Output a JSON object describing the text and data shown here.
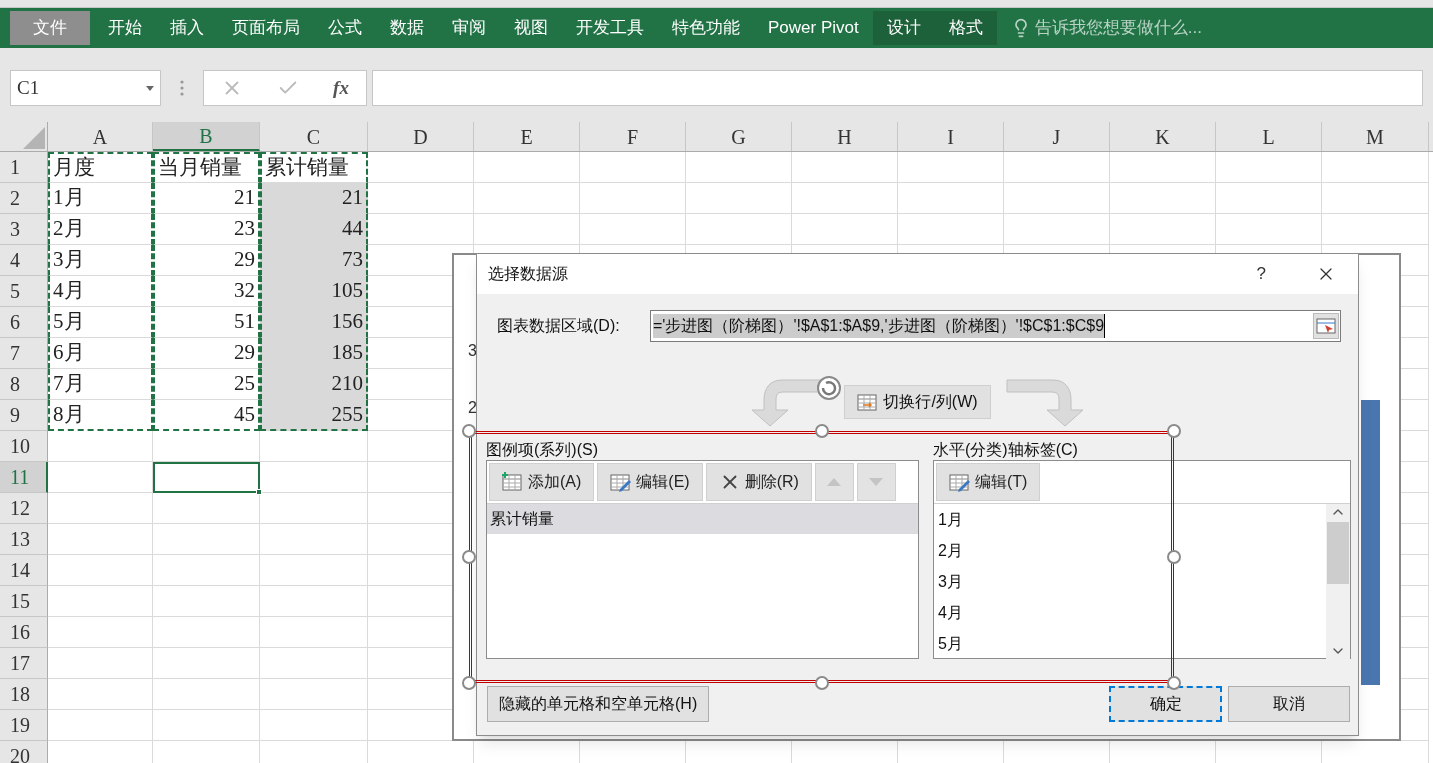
{
  "ribbon": {
    "tabs": [
      {
        "label": "文件",
        "kind": "file",
        "selected": false
      },
      {
        "label": "开始",
        "kind": "normal",
        "selected": false
      },
      {
        "label": "插入",
        "kind": "normal",
        "selected": false
      },
      {
        "label": "页面布局",
        "kind": "normal",
        "selected": false
      },
      {
        "label": "公式",
        "kind": "normal",
        "selected": false
      },
      {
        "label": "数据",
        "kind": "normal",
        "selected": false
      },
      {
        "label": "审阅",
        "kind": "normal",
        "selected": false
      },
      {
        "label": "视图",
        "kind": "normal",
        "selected": false
      },
      {
        "label": "开发工具",
        "kind": "normal",
        "selected": false
      },
      {
        "label": "特色功能",
        "kind": "normal",
        "selected": false
      },
      {
        "label": "Power Pivot",
        "kind": "normal",
        "selected": false
      },
      {
        "label": "设计",
        "kind": "context",
        "selected": false
      },
      {
        "label": "格式",
        "kind": "context",
        "selected": false
      }
    ],
    "tell_me": {
      "placeholder": "告诉我您想要做什么..."
    }
  },
  "formula_bar": {
    "name_box": "C1",
    "function_label": "fx"
  },
  "sheet": {
    "columns": [
      {
        "label": "A",
        "selected": false
      },
      {
        "label": "B",
        "selected": true
      },
      {
        "label": "C",
        "selected": false
      },
      {
        "label": "D",
        "selected": false
      },
      {
        "label": "E",
        "selected": false
      },
      {
        "label": "F",
        "selected": false
      },
      {
        "label": "G",
        "selected": false
      },
      {
        "label": "H",
        "selected": false
      },
      {
        "label": "I",
        "selected": false
      },
      {
        "label": "J",
        "selected": false
      },
      {
        "label": "K",
        "selected": false
      },
      {
        "label": "L",
        "selected": false
      },
      {
        "label": "M",
        "selected": false
      }
    ],
    "rows": [
      {
        "label": "1",
        "selected": false,
        "cells": [
          {
            "text": "月度",
            "kind": "text",
            "marquee": true,
            "highlighted": false,
            "selected": false
          },
          {
            "text": "当月销量",
            "kind": "text",
            "marquee": true,
            "highlighted": false,
            "selected": false
          },
          {
            "text": "累计销量",
            "kind": "text",
            "marquee": true,
            "highlighted": false,
            "selected": false
          }
        ]
      },
      {
        "label": "2",
        "selected": false,
        "cells": [
          {
            "text": "1月",
            "kind": "text",
            "marquee": true,
            "highlighted": false,
            "selected": false
          },
          {
            "text": "21",
            "kind": "number",
            "marquee": true,
            "highlighted": false,
            "selected": false
          },
          {
            "text": "21",
            "kind": "number",
            "marquee": true,
            "highlighted": true,
            "selected": false
          }
        ]
      },
      {
        "label": "3",
        "selected": false,
        "cells": [
          {
            "text": "2月",
            "kind": "text",
            "marquee": true,
            "highlighted": false,
            "selected": false
          },
          {
            "text": "23",
            "kind": "number",
            "marquee": true,
            "highlighted": false,
            "selected": false
          },
          {
            "text": "44",
            "kind": "number",
            "marquee": true,
            "highlighted": true,
            "selected": false
          }
        ]
      },
      {
        "label": "4",
        "selected": false,
        "cells": [
          {
            "text": "3月",
            "kind": "text",
            "marquee": true,
            "highlighted": false,
            "selected": false
          },
          {
            "text": "29",
            "kind": "number",
            "marquee": true,
            "highlighted": false,
            "selected": false
          },
          {
            "text": "73",
            "kind": "number",
            "marquee": true,
            "highlighted": true,
            "selected": false
          }
        ]
      },
      {
        "label": "5",
        "selected": false,
        "cells": [
          {
            "text": "4月",
            "kind": "text",
            "marquee": true,
            "highlighted": false,
            "selected": false
          },
          {
            "text": "32",
            "kind": "number",
            "marquee": true,
            "highlighted": false,
            "selected": false
          },
          {
            "text": "105",
            "kind": "number",
            "marquee": true,
            "highlighted": true,
            "selected": false
          }
        ]
      },
      {
        "label": "6",
        "selected": false,
        "cells": [
          {
            "text": "5月",
            "kind": "text",
            "marquee": true,
            "highlighted": false,
            "selected": false
          },
          {
            "text": "51",
            "kind": "number",
            "marquee": true,
            "highlighted": false,
            "selected": false
          },
          {
            "text": "156",
            "kind": "number",
            "marquee": true,
            "highlighted": true,
            "selected": false
          }
        ]
      },
      {
        "label": "7",
        "selected": false,
        "cells": [
          {
            "text": "6月",
            "kind": "text",
            "marquee": true,
            "highlighted": false,
            "selected": false
          },
          {
            "text": "29",
            "kind": "number",
            "marquee": true,
            "highlighted": false,
            "selected": false
          },
          {
            "text": "185",
            "kind": "number",
            "marquee": true,
            "highlighted": true,
            "selected": false
          }
        ]
      },
      {
        "label": "8",
        "selected": false,
        "cells": [
          {
            "text": "7月",
            "kind": "text",
            "marquee": true,
            "highlighted": false,
            "selected": false
          },
          {
            "text": "25",
            "kind": "number",
            "marquee": true,
            "highlighted": false,
            "selected": false
          },
          {
            "text": "210",
            "kind": "number",
            "marquee": true,
            "highlighted": true,
            "selected": false
          }
        ]
      },
      {
        "label": "9",
        "selected": false,
        "cells": [
          {
            "text": "8月",
            "kind": "text",
            "marquee": true,
            "highlighted": false,
            "selected": false
          },
          {
            "text": "45",
            "kind": "number",
            "marquee": true,
            "highlighted": false,
            "selected": false
          },
          {
            "text": "255",
            "kind": "number",
            "marquee": true,
            "highlighted": true,
            "selected": false
          }
        ]
      },
      {
        "label": "10",
        "selected": false
      },
      {
        "label": "11",
        "selected": true,
        "cells": [
          {
            "marquee": false,
            "highlighted": false,
            "selected": false
          },
          {
            "marquee": false,
            "highlighted": false,
            "selected": true
          }
        ]
      },
      {
        "label": "12",
        "selected": false
      },
      {
        "label": "13",
        "selected": false
      },
      {
        "label": "14",
        "selected": false
      },
      {
        "label": "15",
        "selected": false
      },
      {
        "label": "16",
        "selected": false
      },
      {
        "label": "17",
        "selected": false
      },
      {
        "label": "18",
        "selected": false
      },
      {
        "label": "19",
        "selected": false
      },
      {
        "label": "20",
        "selected": false
      }
    ]
  },
  "chart": {
    "tick_labels": [
      "3",
      "2"
    ]
  },
  "dialog": {
    "title": "选择数据源",
    "help": "?",
    "data_range": {
      "label": "图表数据区域(D):",
      "value": "='步进图（阶梯图）'!$A$1:$A$9,'步进图（阶梯图）'!$C$1:$C$9"
    },
    "switch_button": "切换行/列(W)",
    "series": {
      "label": "图例项(系列)(S)",
      "buttons": [
        {
          "kind": "add",
          "label": "添加(A)",
          "disabled": false
        },
        {
          "kind": "edit",
          "label": "编辑(E)",
          "disabled": false
        },
        {
          "kind": "delete",
          "label": "删除(R)",
          "disabled": false
        },
        {
          "kind": "up",
          "disabled": true
        },
        {
          "kind": "down",
          "disabled": true
        }
      ],
      "items": [
        {
          "label": "累计销量",
          "selected": true
        }
      ]
    },
    "axis": {
      "label": "水平(分类)轴标签(C)",
      "button": "编辑(T)",
      "items": [
        {
          "label": "1月",
          "selected": false
        },
        {
          "label": "2月",
          "selected": false
        },
        {
          "label": "3月",
          "selected": false
        },
        {
          "label": "4月",
          "selected": false
        },
        {
          "label": "5月",
          "selected": false
        }
      ]
    },
    "hidden_cells_button": "隐藏的单元格和空单元格(H)",
    "ok": {
      "label": "确定",
      "default": true
    },
    "cancel": "取消"
  }
}
